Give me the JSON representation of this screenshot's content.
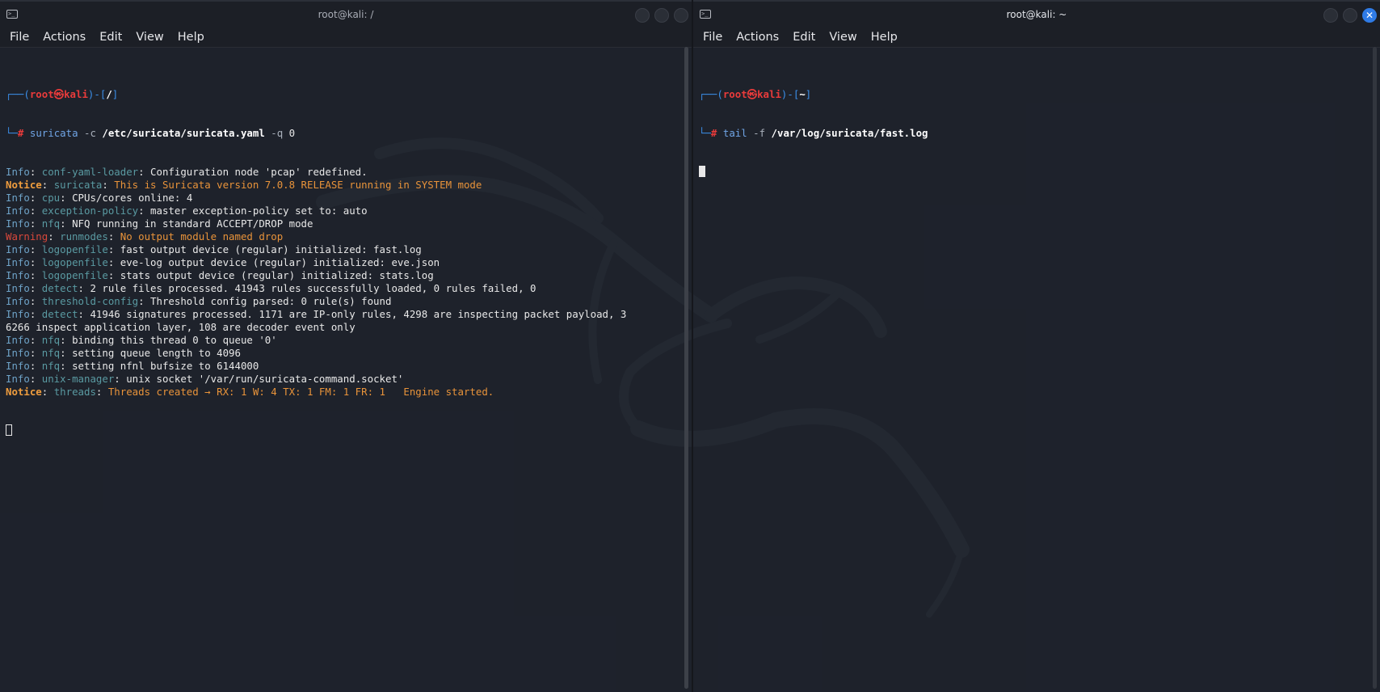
{
  "colors": {
    "background": "#1f232b",
    "accent": "#2f7be6"
  },
  "left_window": {
    "title": "root@kali: /",
    "icon": "terminal-icon",
    "menu": [
      "File",
      "Actions",
      "Edit",
      "View",
      "Help"
    ],
    "prompt": {
      "line1_prefix": "┌──(",
      "user": "root㉿kali",
      "mid": ")-[",
      "dir": "/",
      "suffix": "]",
      "line2_prefix": "└─",
      "hash": "#",
      "cmd": "suricata",
      "opt1": " -c ",
      "file": "/etc/suricata/suricata.yaml",
      "opt2": " -q ",
      "qnum": "0"
    },
    "log": [
      {
        "level": "Info",
        "module": "conf-yaml-loader",
        "msg": "Configuration node 'pcap' redefined."
      },
      {
        "level": "Notice",
        "module": "suricata",
        "msg": "This is Suricata version 7.0.8 RELEASE running in SYSTEM mode"
      },
      {
        "level": "Info",
        "module": "cpu",
        "msg": "CPUs/cores online: 4"
      },
      {
        "level": "Info",
        "module": "exception-policy",
        "msg": "master exception-policy set to: auto"
      },
      {
        "level": "Info",
        "module": "nfq",
        "msg": "NFQ running in standard ACCEPT/DROP mode"
      },
      {
        "level": "Warning",
        "module": "runmodes",
        "msg": "No output module named drop"
      },
      {
        "level": "Info",
        "module": "logopenfile",
        "msg": "fast output device (regular) initialized: fast.log"
      },
      {
        "level": "Info",
        "module": "logopenfile",
        "msg": "eve-log output device (regular) initialized: eve.json"
      },
      {
        "level": "Info",
        "module": "logopenfile",
        "msg": "stats output device (regular) initialized: stats.log"
      },
      {
        "level": "Info",
        "module": "detect",
        "msg": "2 rule files processed. 41943 rules successfully loaded, 0 rules failed, 0"
      },
      {
        "level": "Info",
        "module": "threshold-config",
        "msg": "Threshold config parsed: 0 rule(s) found"
      },
      {
        "level": "Info",
        "module": "detect",
        "msg": "41946 signatures processed. 1171 are IP-only rules, 4298 are inspecting packet payload, 3"
      },
      {
        "level": "",
        "module": "",
        "msg": "6266 inspect application layer, 108 are decoder event only"
      },
      {
        "level": "Info",
        "module": "nfq",
        "msg": "binding this thread 0 to queue '0'"
      },
      {
        "level": "Info",
        "module": "nfq",
        "msg": "setting queue length to 4096"
      },
      {
        "level": "Info",
        "module": "nfq",
        "msg": "setting nfnl bufsize to 6144000"
      },
      {
        "level": "Info",
        "module": "unix-manager",
        "msg": "unix socket '/var/run/suricata-command.socket'"
      },
      {
        "level": "Notice",
        "module": "threads",
        "msg": "Threads created → RX: 1 W: 4 TX: 1 FM: 1 FR: 1   Engine started."
      }
    ]
  },
  "right_window": {
    "title": "root@kali: ~",
    "icon": "terminal-icon",
    "close_glyph": "✕",
    "menu": [
      "File",
      "Actions",
      "Edit",
      "View",
      "Help"
    ],
    "prompt": {
      "line1_prefix": "┌──(",
      "user": "root㉿kali",
      "mid": ")-[",
      "dir": "~",
      "suffix": "]",
      "line2_prefix": "└─",
      "hash": "#",
      "cmd": "tail",
      "opt1": " -f ",
      "file": "/var/log/suricata/fast.log"
    }
  }
}
